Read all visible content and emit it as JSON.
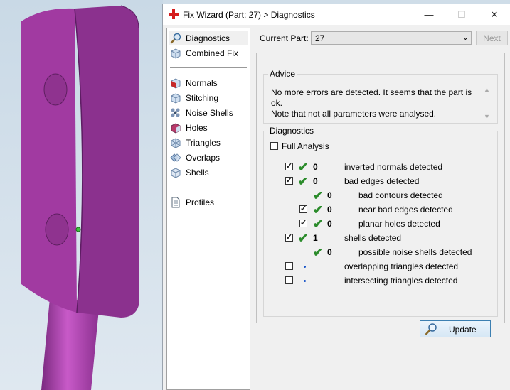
{
  "dialog": {
    "title": "Fix Wizard (Part: 27) > Diagnostics",
    "minimize_glyph": "—",
    "maximize_glyph": "☐",
    "close_glyph": "✕"
  },
  "nav": {
    "items": [
      {
        "label": "Diagnostics",
        "icon": "magnifier-icon"
      },
      {
        "label": "Combined Fix",
        "icon": "cube-icon"
      },
      {
        "label": "Normals",
        "icon": "normals-cube-icon"
      },
      {
        "label": "Stitching",
        "icon": "stitching-cube-icon"
      },
      {
        "label": "Noise Shells",
        "icon": "noise-shells-icon"
      },
      {
        "label": "Holes",
        "icon": "holes-cube-icon"
      },
      {
        "label": "Triangles",
        "icon": "triangles-icon"
      },
      {
        "label": "Overlaps",
        "icon": "overlaps-icon"
      },
      {
        "label": "Shells",
        "icon": "shells-icon"
      },
      {
        "label": "Profiles",
        "icon": "document-icon"
      }
    ]
  },
  "current_part": {
    "label": "Current Part:",
    "value": "27",
    "next_label": "Next"
  },
  "advice": {
    "legend": "Advice",
    "line1": "No more errors are detected. It seems that the part is ok.",
    "line2": "Note that not all parameters were analysed."
  },
  "diagnostics": {
    "legend": "Diagnostics",
    "full_analysis": "Full Analysis",
    "rows": [
      {
        "count": "0",
        "text": "inverted normals detected"
      },
      {
        "count": "0",
        "text": "bad edges detected"
      },
      {
        "count": "0",
        "text": "bad contours detected"
      },
      {
        "count": "0",
        "text": "near bad edges detected"
      },
      {
        "count": "0",
        "text": "planar holes detected"
      },
      {
        "count": "1",
        "text": "shells detected"
      },
      {
        "count": "0",
        "text": "possible noise shells detected"
      },
      {
        "count": "",
        "text": "overlapping triangles detected"
      },
      {
        "count": "",
        "text": "intersecting triangles detected"
      }
    ],
    "update_label": "Update"
  },
  "colors": {
    "part": "#a13aa1",
    "part_dark": "#7b2a80",
    "check": "#2a8b2a",
    "accent": "#3c7fb1"
  }
}
